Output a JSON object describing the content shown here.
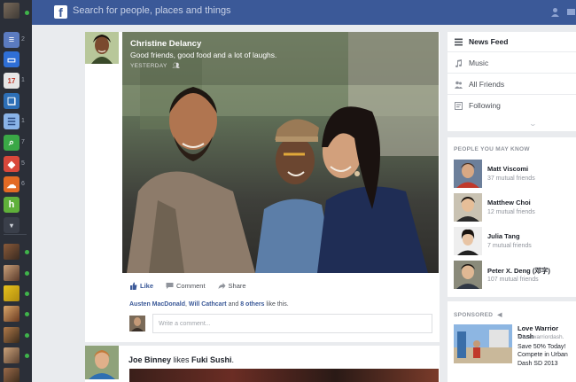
{
  "search": {
    "placeholder": "Search for people, places and things"
  },
  "rail": {
    "app_counts": [
      "2",
      "",
      "1",
      "",
      "1",
      "7",
      "5",
      "6",
      "",
      ""
    ]
  },
  "post": {
    "author": "Christine Delancy",
    "text": "Good friends, good food and a lot of laughs.",
    "time": "YESTERDAY",
    "actions": {
      "like": "Like",
      "comment": "Comment",
      "share": "Share"
    },
    "likes": {
      "name1": "Austen MacDonald",
      "sep": ", ",
      "name2": "Will Cathcart",
      "and": " and ",
      "others": "8 others",
      "suffix": " like this."
    },
    "comment_placeholder": "Write a comment..."
  },
  "post2": {
    "author": "Joe Binney",
    "verb": " likes ",
    "page": "Fuki Sushi",
    "end": "."
  },
  "nav": {
    "items": [
      {
        "label": "News Feed",
        "icon": "list-icon"
      },
      {
        "label": "Music",
        "icon": "music-note-icon"
      },
      {
        "label": "All Friends",
        "icon": "friends-icon"
      },
      {
        "label": "Following",
        "icon": "following-icon"
      }
    ]
  },
  "pymk": {
    "title": "PEOPLE YOU MAY KNOW",
    "people": [
      {
        "name": "Matt Viscomi",
        "mutual": "37 mutual friends"
      },
      {
        "name": "Matthew Choi",
        "mutual": "12 mutual friends"
      },
      {
        "name": "Julia Tang",
        "mutual": "7 mutual friends"
      },
      {
        "name": "Peter X. Deng (邓字)",
        "mutual": "107 mutual friends"
      }
    ]
  },
  "sponsored": {
    "title": "SPONSORED",
    "ad_title": "Love Warrior Dash",
    "ad_url": "urbanwarriordash.",
    "ad_text": "Save 50% Today! Compete in Urban Dash SD 2013"
  },
  "colors": {
    "brand": "#3b5998",
    "rail": "#2b2f38",
    "background": "#e9ebee"
  }
}
